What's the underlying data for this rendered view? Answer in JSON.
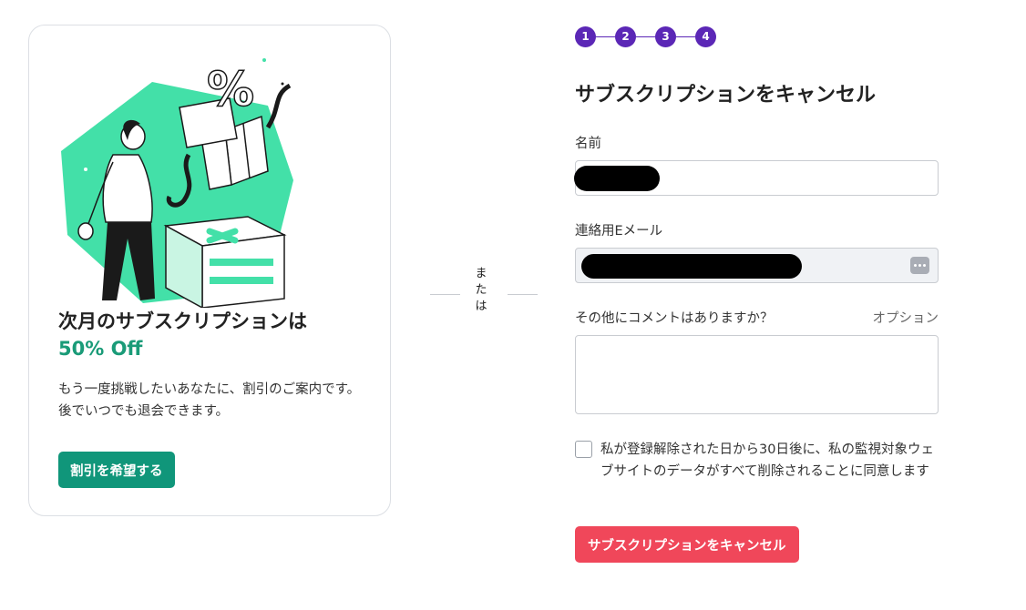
{
  "offer": {
    "title": "次月のサブスクリプションは",
    "discount": "50% Off",
    "description": "もう一度挑戦したいあなたに、割引のご案内です。後でいつでも退会できます。",
    "button_label": "割引を希望する"
  },
  "divider": {
    "or_text": "または"
  },
  "stepper": {
    "steps": [
      "1",
      "2",
      "3",
      "4"
    ]
  },
  "form": {
    "title": "サブスクリプションをキャンセル",
    "name_label": "名前",
    "email_label": "連絡用Eメール",
    "comment_label": "その他にコメントはありますか？",
    "optional_label": "オプション",
    "consent_text": "私が登録解除された日から30日後に、私の監視対象ウェブサイトのデータがすべて削除されることに同意します",
    "submit_label": "サブスクリプションをキャンセル"
  },
  "colors": {
    "accent_green": "#10967a",
    "discount_green": "#1a9b78",
    "illustration_green": "#43e0a8",
    "step_purple": "#5b27b6",
    "cancel_red": "#f0475a"
  },
  "icons": {
    "email_field_icon": "password-manager-icon"
  }
}
